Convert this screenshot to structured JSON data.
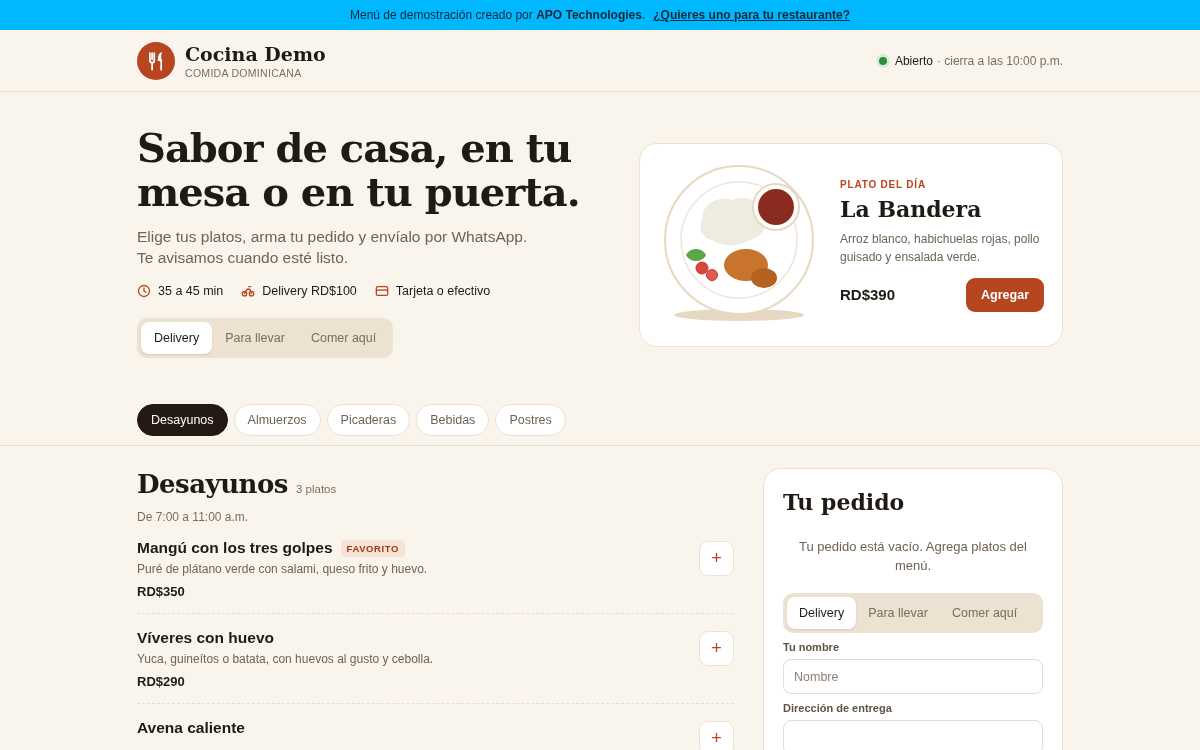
{
  "banner": {
    "text": "Menú de demostración creado por **APO Technologies**.",
    "link": "¿Quieres uno para tu restaurante?"
  },
  "header": {
    "name": "Cocina Demo",
    "subtitle": "COMIDA DOMINICANA",
    "status": "Abierto",
    "status_open": true,
    "hours": "· cierra a las 10:00 p.m."
  },
  "hero": {
    "title": "Sabor de casa, en tu mesa o en tu puerta.",
    "intro": "Elige tus platos, arma tu pedido y envíalo por WhatsApp. Te avisamos cuando esté listo.",
    "facts": [
      {
        "kind": "time",
        "text": "35 a 45 min"
      },
      {
        "kind": "delivery",
        "text": "Delivery RD$100"
      },
      {
        "kind": "payment",
        "text": "Tarjeta o efectivo"
      }
    ],
    "modes": [
      {
        "label": "Delivery",
        "selected": true
      },
      {
        "label": "Para llevar",
        "selected": false
      },
      {
        "label": "Comer aquí",
        "selected": false
      }
    ]
  },
  "special": {
    "kicker": "PLATO DEL DÍA",
    "name": "La Bandera",
    "description": "Arroz blanco, habichuelas rojas, pollo guisado y ensalada verde.",
    "price": "RD$390",
    "button": "Agregar"
  },
  "categories": [
    {
      "label": "Desayunos",
      "selected": true
    },
    {
      "label": "Almuerzos",
      "selected": false
    },
    {
      "label": "Picaderas",
      "selected": false
    },
    {
      "label": "Bebidas",
      "selected": false
    },
    {
      "label": "Postres",
      "selected": false
    }
  ],
  "section": {
    "title": "Desayunos",
    "count": "3 platos",
    "hours": "De 7:00 a 11:00 a.m.",
    "items": [
      {
        "name": "Mangú con los tres golpes",
        "badge": "FAVORITO",
        "description": "Puré de plátano verde con salami, queso frito y huevo.",
        "price": "RD$350",
        "add": "+"
      },
      {
        "name": "Víveres con huevo",
        "description": "Yuca, guineítos o batata, con huevos al gusto y cebolla.",
        "price": "RD$290",
        "add": "+"
      },
      {
        "name": "Avena caliente",
        "add": "+"
      }
    ]
  },
  "order": {
    "title": "Tu pedido",
    "empty": "Tu pedido está vacío. Agrega platos del menú.",
    "modes": [
      {
        "label": "Delivery",
        "selected": true
      },
      {
        "label": "Para llevar",
        "selected": false
      },
      {
        "label": "Comer aquí",
        "selected": false
      }
    ],
    "fields": [
      {
        "label": "Tu nombre",
        "placeholder": "Nombre"
      },
      {
        "label": "Dirección de entrega"
      }
    ]
  }
}
